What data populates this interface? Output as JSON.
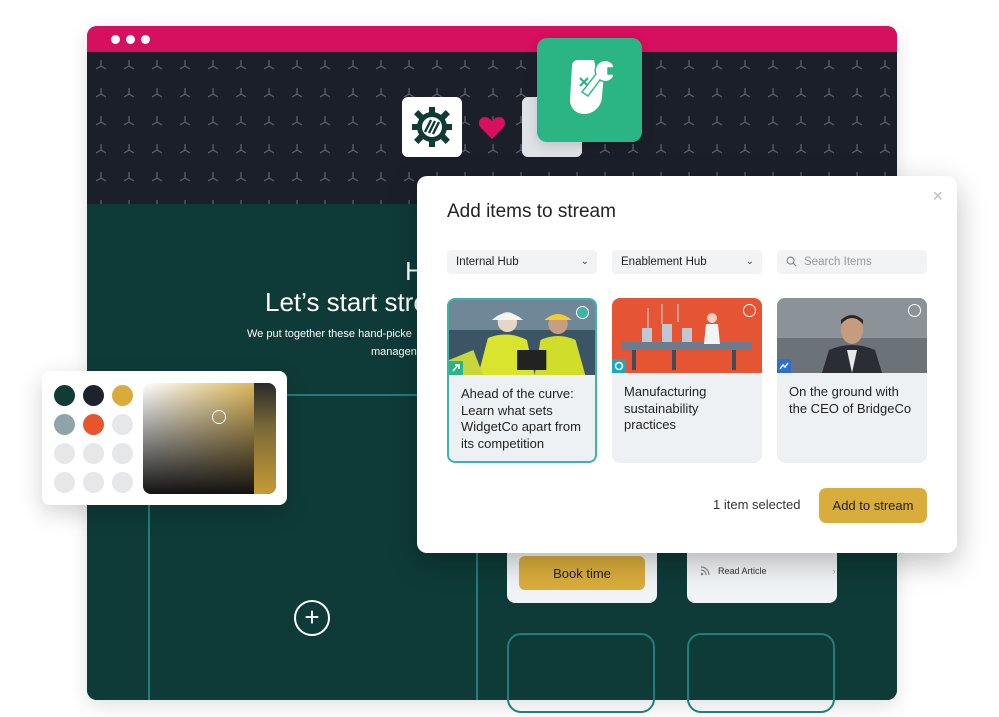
{
  "hero": {
    "heading_partial": "H",
    "heading_line2": "Let’s start stre",
    "sub_line1": "We put together these hand-picke",
    "sub_line2": "managen"
  },
  "cards": {
    "book_label": "Book time",
    "read_label": "Read Article"
  },
  "palette": {
    "swatches": [
      "#103b36",
      "#1d232c",
      "#d9ab3b",
      "#8ea4ab",
      "#e8542c",
      "#e5e7e8",
      "#e5e7e8",
      "#e5e7e8",
      "#e5e7e8",
      "#e5e7e8",
      "#e5e7e8",
      "#e5e7e8"
    ]
  },
  "modal": {
    "title": "Add items to stream",
    "close_icon": "×",
    "filter1": "Internal Hub",
    "filter2": "Enablement Hub",
    "search_placeholder": "Search Items",
    "items": [
      {
        "title": "Ahead of the curve: Learn what sets WidgetCo apart from its competition",
        "selected": true
      },
      {
        "title": "Manufacturing sustainability practices",
        "selected": false
      },
      {
        "title": "On the ground with the CEO of BridgeCo",
        "selected": false
      }
    ],
    "selected_count": "1 item selected",
    "add_label": "Add to stream"
  },
  "colors": {
    "brand_pink": "#d60f5e",
    "teal_bg": "#0e3b38",
    "accent_gold": "#d9ad3c",
    "select_teal": "#3ab5ab"
  }
}
